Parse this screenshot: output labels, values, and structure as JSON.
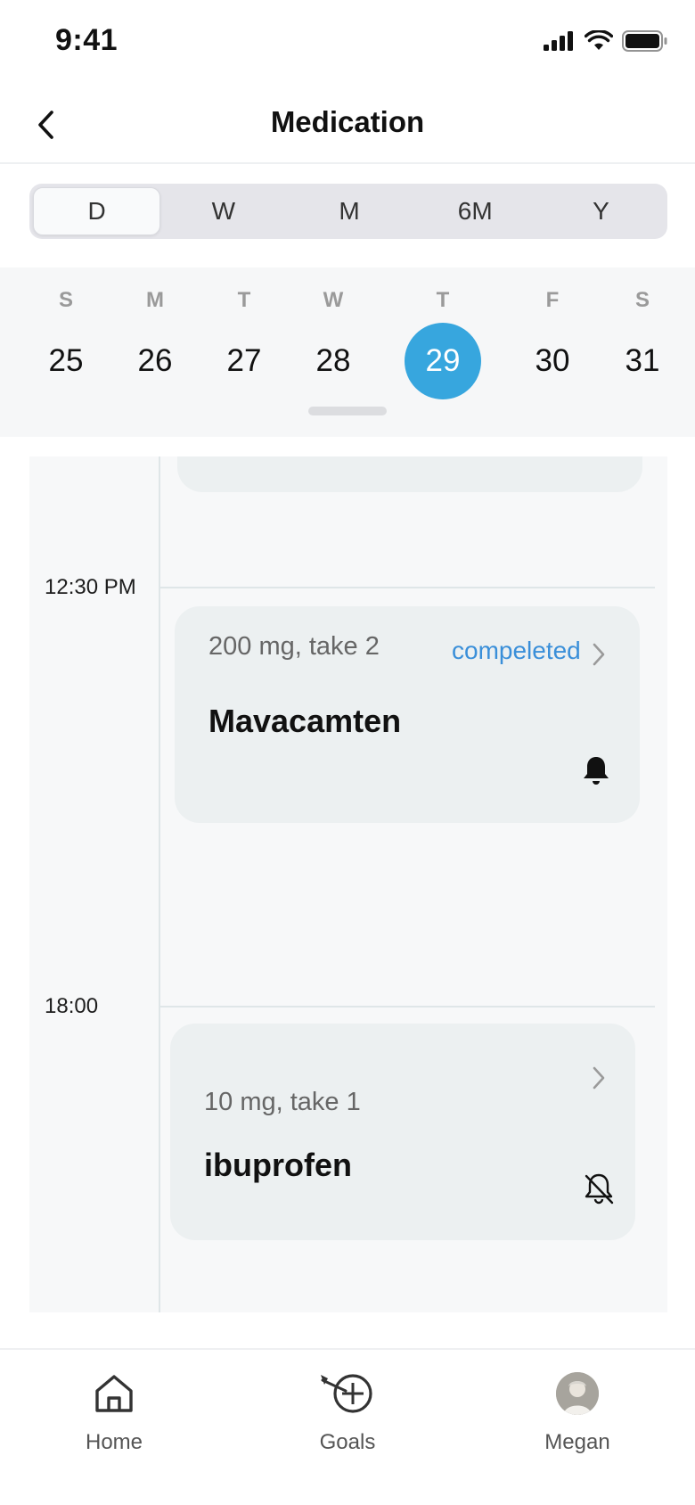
{
  "status_bar": {
    "time": "9:41"
  },
  "header": {
    "title": "Medication"
  },
  "segments": [
    "D",
    "W",
    "M",
    "6M",
    "Y"
  ],
  "segment_selected": "D",
  "week": {
    "days": [
      {
        "letter": "S",
        "number": "25"
      },
      {
        "letter": "M",
        "number": "26"
      },
      {
        "letter": "T",
        "number": "27"
      },
      {
        "letter": "W",
        "number": "28"
      },
      {
        "letter": "T",
        "number": "29"
      },
      {
        "letter": "F",
        "number": "30"
      },
      {
        "letter": "S",
        "number": "31"
      }
    ],
    "selected_number": "29"
  },
  "schedule": [
    {
      "time": "12:30 PM",
      "dose": "200 mg, take 2",
      "name": "Mavacamten",
      "status": "compeleted",
      "reminder": "bell-icon"
    },
    {
      "time": "18:00",
      "dose": "10 mg, take 1",
      "name": "ibuprofen",
      "status": "",
      "reminder": "bell-off-icon"
    }
  ],
  "tabs": [
    {
      "label": "Home",
      "icon": "home-icon"
    },
    {
      "label": "Goals",
      "icon": "goals-target-icon"
    },
    {
      "label": "Megan",
      "icon": "avatar"
    }
  ],
  "colors": {
    "accent": "#37a6de",
    "status_text": "#3a8fd9",
    "card_bg": "#ecf0f1",
    "timeline_bg": "#f7f8f9"
  }
}
